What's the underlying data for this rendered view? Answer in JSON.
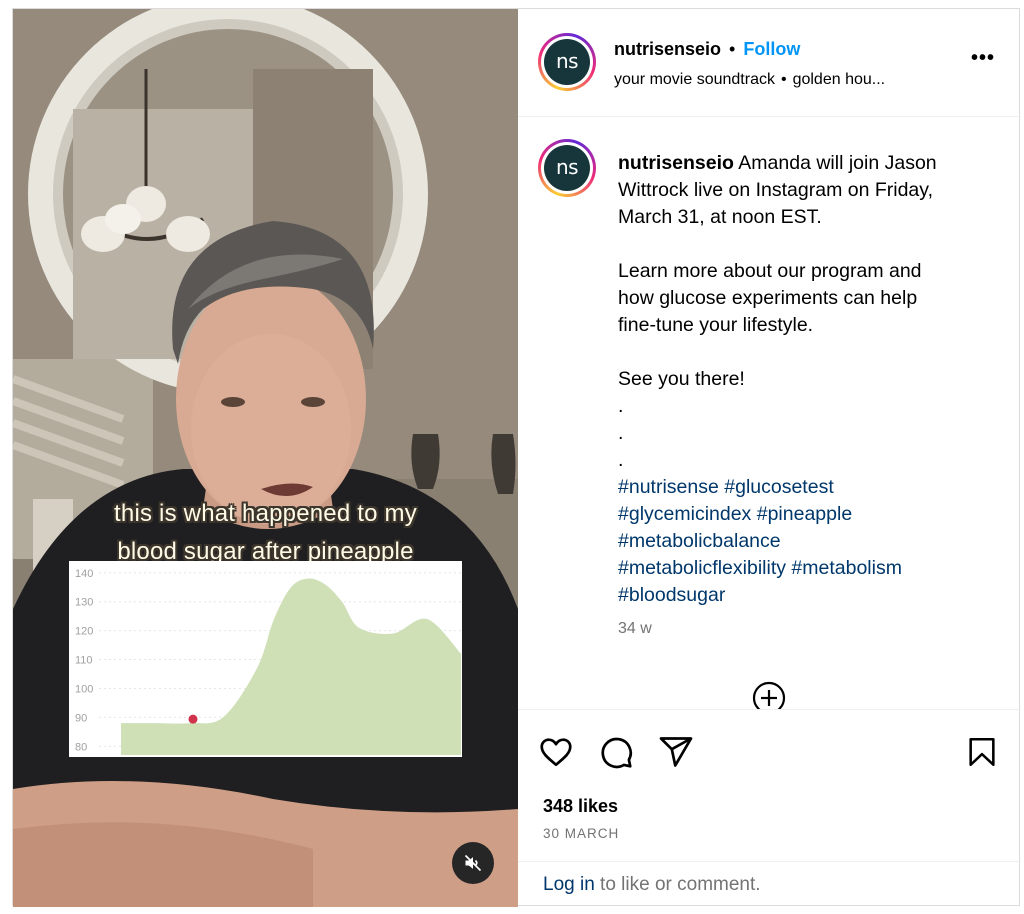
{
  "header": {
    "avatar_text": "ns",
    "username": "nutrisenseio",
    "separator": "•",
    "follow_label": "Follow",
    "audio_track": "your movie soundtrack",
    "audio_sep": "•",
    "audio_artist": "golden hou...",
    "more_label": "•••"
  },
  "video": {
    "caption_line1": "this is what happened to my",
    "caption_line2": "blood sugar after pineapple",
    "muted": true
  },
  "chart_data": {
    "type": "area",
    "y_ticks": [
      140,
      130,
      120,
      110,
      100,
      90,
      80
    ],
    "ylim": [
      77,
      142
    ],
    "x": [
      0,
      10,
      20,
      30,
      40,
      45,
      50,
      55,
      60,
      65,
      70,
      80,
      90,
      100
    ],
    "values": [
      88,
      88,
      88,
      90,
      107,
      124,
      135,
      138,
      136,
      130,
      121,
      119,
      124,
      112
    ],
    "marker": {
      "x": 10,
      "y": 88,
      "color": "#d2334c"
    },
    "fill_color": "#cfe0b7",
    "grid": true
  },
  "post": {
    "avatar_text": "ns",
    "username": "nutrisenseio",
    "caption_lines": [
      "Amanda will join Jason",
      "Wittrock live on Instagram on Friday,",
      "March 31, at noon EST."
    ],
    "para2": [
      "Learn more about our program and",
      "how glucose experiments can help",
      "fine-tune your lifestyle."
    ],
    "para3": "See you there!",
    "dots": [
      ".",
      ".",
      "."
    ],
    "hashtags": [
      "#nutrisense",
      "#glucosetest",
      "#glycemicindex",
      "#pineapple",
      "#metabolicbalance",
      "#metabolicflexibility",
      "#metabolism",
      "#bloodsugar"
    ],
    "time_ago": "34 w"
  },
  "actions": {
    "icons": [
      "heart-icon",
      "comment-icon",
      "share-icon",
      "bookmark-icon"
    ],
    "likes": "348 likes",
    "date": "30 MARCH"
  },
  "footer": {
    "login_link": "Log in",
    "login_rest": " to like or comment."
  }
}
